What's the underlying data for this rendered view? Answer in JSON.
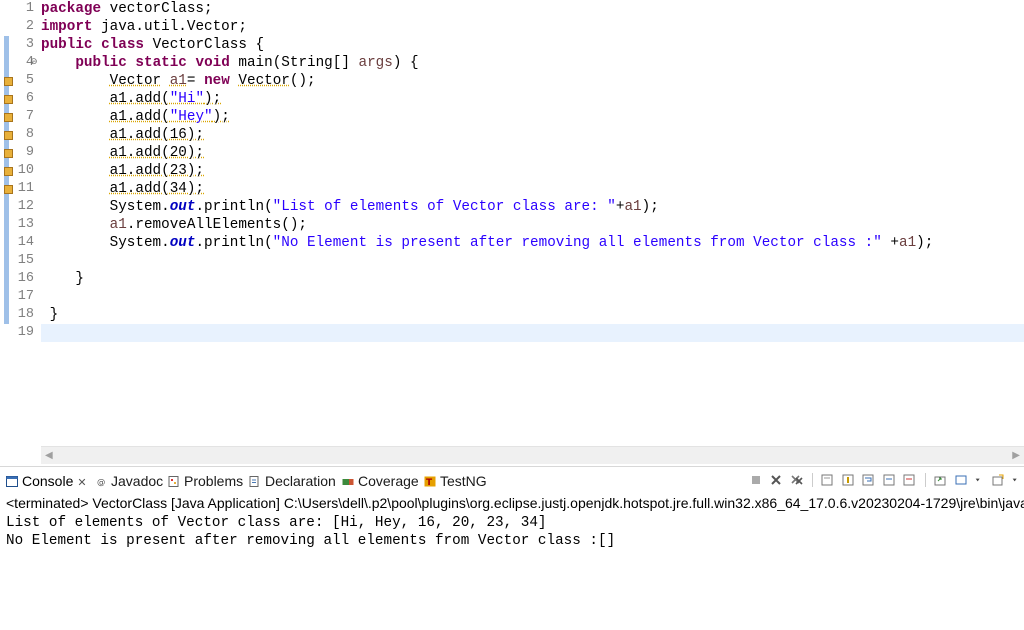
{
  "editor": {
    "line_numbers": [
      "1",
      "2",
      "3",
      "4",
      "5",
      "6",
      "7",
      "8",
      "9",
      "10",
      "11",
      "12",
      "13",
      "14",
      "15",
      "16",
      "17",
      "18",
      "19"
    ],
    "warning_lines": [
      5,
      6,
      7,
      8,
      9,
      10,
      11
    ],
    "fold_marker": "⊖",
    "code": {
      "l1": {
        "kw": "package",
        "rest": " vectorClass;"
      },
      "l2": {
        "kw": "import",
        "rest": " java.util.Vector;"
      },
      "l3": {
        "kw1": "public",
        "kw2": "class",
        "rest": " VectorClass {"
      },
      "l4": {
        "indent": "    ",
        "kw1": "public",
        "kw2": "static",
        "kw3": "void",
        "name": " main(String[] ",
        "param": "args",
        "rest": ") {"
      },
      "l5": {
        "indent": "        ",
        "type": "Vector",
        "sp": " ",
        "var": "a1",
        "eq": "= ",
        "kw": "new",
        "sp2": " ",
        "ctor": "Vector",
        "rest": "();"
      },
      "l6": {
        "indent": "        ",
        "expr": "a1.add(",
        "str": "\"Hi\"",
        "rest": ");"
      },
      "l7": {
        "indent": "        ",
        "expr": "a1.add(",
        "str": "\"Hey\"",
        "rest": ");"
      },
      "l8": {
        "indent": "        ",
        "expr": "a1.add(16);"
      },
      "l9": {
        "indent": "        ",
        "expr": "a1.add(20);"
      },
      "l10": {
        "indent": "        ",
        "expr": "a1.add(23);"
      },
      "l11": {
        "indent": "        ",
        "expr": "a1.add(34);"
      },
      "l12": {
        "indent": "        ",
        "pre": "System.",
        "field": "out",
        "mid": ".println(",
        "str": "\"List of elements of Vector class are: \"",
        "plus": "+",
        "var": "a1",
        "rest": ");"
      },
      "l13": {
        "indent": "        ",
        "var": "a1",
        "rest": ".removeAllElements();"
      },
      "l14": {
        "indent": "        ",
        "pre": "System.",
        "field": "out",
        "mid": ".println(",
        "str": "\"No Element is present after removing all elements from Vector class :\"",
        "plus": " +",
        "var": "a1",
        "rest": ");"
      },
      "l16": {
        "indent": "    ",
        "text": "}"
      },
      "l18": {
        "indent": " ",
        "text": "}"
      }
    }
  },
  "scrollbar": {
    "left_arrow": "◀",
    "right_arrow": "▶"
  },
  "views": {
    "tabs": [
      {
        "label": "Console",
        "icon": "console-icon",
        "active": true
      },
      {
        "label": "Javadoc",
        "icon": "javadoc-icon"
      },
      {
        "label": "Problems",
        "icon": "problems-icon"
      },
      {
        "label": "Declaration",
        "icon": "declaration-icon"
      },
      {
        "label": "Coverage",
        "icon": "coverage-icon"
      },
      {
        "label": "TestNG",
        "icon": "testng-icon"
      }
    ],
    "close_glyph": "✕"
  },
  "console": {
    "status": "<terminated> VectorClass [Java Application] C:\\Users\\dell\\.p2\\pool\\plugins\\org.eclipse.justj.openjdk.hotspot.jre.full.win32.x86_64_17.0.6.v20230204-1729\\jre\\bin\\javaw.exe",
    "output": [
      "List of elements of Vector class are: [Hi, Hey, 16, 20, 23, 34]",
      "No Element is present after removing all elements from Vector class :[]"
    ]
  },
  "colors": {
    "keyword": "#7f0055",
    "string": "#2a00ff",
    "field": "#0000c0",
    "variable": "#6a3e3e",
    "current_line": "#e8f2fe"
  }
}
